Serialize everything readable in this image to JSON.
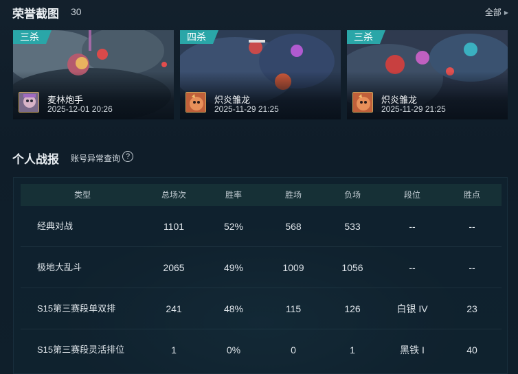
{
  "honor": {
    "title": "荣誉截图",
    "count": "30",
    "view_all": "全部",
    "cards": [
      {
        "badge": "三杀",
        "champion": "麦林炮手",
        "time": "2025-12-01 20:26"
      },
      {
        "badge": "四杀",
        "champion": "炽炎雏龙",
        "time": "2025-11-29 21:25"
      },
      {
        "badge": "三杀",
        "champion": "炽炎雏龙",
        "time": "2025-11-29 21:25"
      }
    ]
  },
  "stats": {
    "title": "个人战报",
    "abnormal_query": "账号异常查询",
    "help": "?",
    "columns": [
      "类型",
      "总场次",
      "胜率",
      "胜场",
      "负场",
      "段位",
      "胜点"
    ],
    "rows": [
      {
        "type": "经典对战",
        "total": "1101",
        "winrate": "52%",
        "wins": "568",
        "losses": "533",
        "rank": "--",
        "points": "--"
      },
      {
        "type": "极地大乱斗",
        "total": "2065",
        "winrate": "49%",
        "wins": "1009",
        "losses": "1056",
        "rank": "--",
        "points": "--"
      },
      {
        "type": "S15第三赛段单双排",
        "total": "241",
        "winrate": "48%",
        "wins": "115",
        "losses": "126",
        "rank": "白银 IV",
        "points": "23"
      },
      {
        "type": "S15第三赛段灵活排位",
        "total": "1",
        "winrate": "0%",
        "wins": "0",
        "losses": "1",
        "rank": "黑铁 I",
        "points": "40"
      }
    ]
  },
  "colors": {
    "accent_badge": "#2aa6a8",
    "background": "#0f1e2b",
    "table_header": "#163036"
  }
}
